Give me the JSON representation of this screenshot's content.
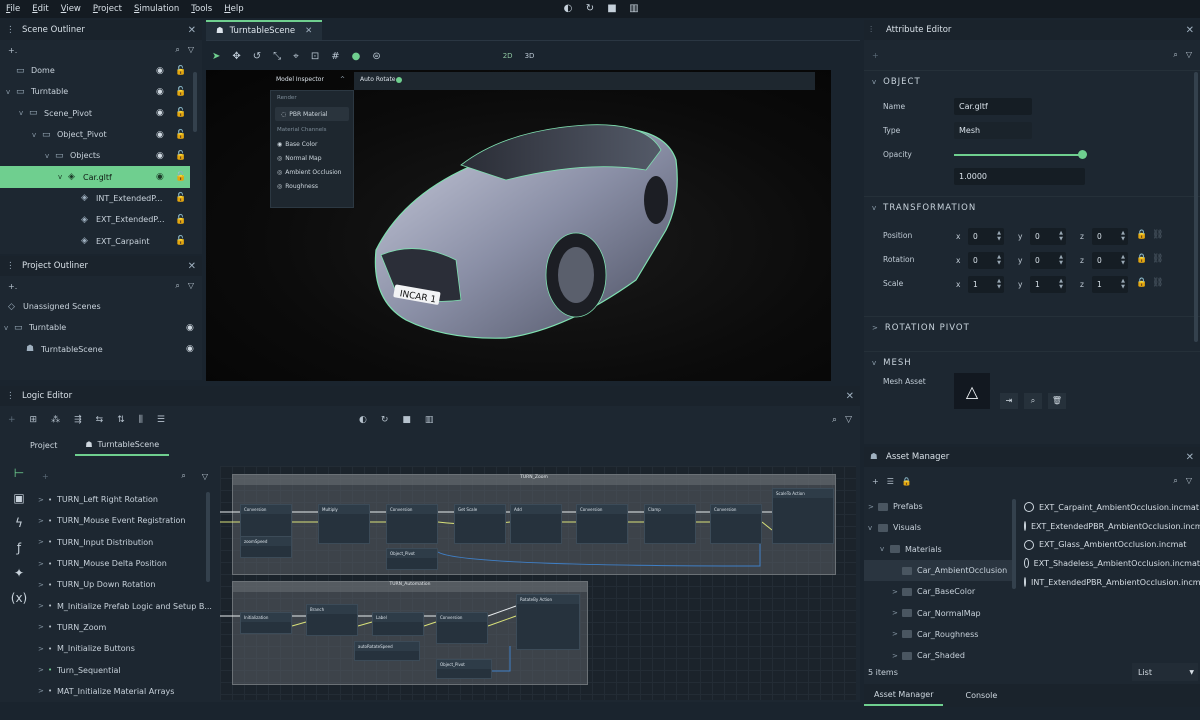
{
  "menu": [
    "File",
    "Edit",
    "View",
    "Project",
    "Simulation",
    "Tools",
    "Help"
  ],
  "sim_icons": [
    "camera-icon",
    "reset-icon",
    "stop-icon",
    "timeline-icon"
  ],
  "scene_outliner": {
    "title": "Scene Outliner",
    "items": [
      {
        "label": "Dome",
        "level": 0,
        "chev": ""
      },
      {
        "label": "Turntable",
        "level": 0,
        "chev": "v"
      },
      {
        "label": "Scene_Pivot",
        "level": 1,
        "chev": "v"
      },
      {
        "label": "Object_Pivot",
        "level": 2,
        "chev": "v"
      },
      {
        "label": "Objects",
        "level": 3,
        "chev": "v"
      },
      {
        "label": "Car.gltf",
        "level": 4,
        "chev": "v",
        "selected": true
      },
      {
        "label": "INT_ExtendedP...",
        "level": 5,
        "chev": ""
      },
      {
        "label": "EXT_ExtendedP...",
        "level": 5,
        "chev": ""
      },
      {
        "label": "EXT_Carpaint",
        "level": 5,
        "chev": ""
      }
    ]
  },
  "project_outliner": {
    "title": "Project Outliner",
    "items": [
      {
        "label": "Unassigned Scenes"
      },
      {
        "label": "Turntable"
      },
      {
        "label": "TurntableScene"
      }
    ]
  },
  "viewport": {
    "tab": "TurntableScene",
    "mode_2d": "2D",
    "mode_3d": "3D",
    "inspector": {
      "title": "Model Inspector",
      "auto_rotate": "Auto Rotate",
      "render_hd": "Render",
      "material": "PBR Material",
      "channels_hd": "Material Channels",
      "channels": [
        "Base Color",
        "Normal Map",
        "Ambient Occlusion",
        "Roughness"
      ]
    },
    "plate": "INCAR 1"
  },
  "attribute_editor": {
    "title": "Attribute Editor",
    "object_hd": "OBJECT",
    "name_label": "Name",
    "name_value": "Car.gltf",
    "type_label": "Type",
    "type_value": "Mesh",
    "opacity_label": "Opacity",
    "opacity_value": "1.0000",
    "opacity_fraction": 1.0,
    "transform_hd": "TRANSFORMATION",
    "position_label": "Position",
    "rotation_label": "Rotation",
    "scale_label": "Scale",
    "position": [
      "0",
      "0",
      "0"
    ],
    "rotation": [
      "0",
      "0",
      "0"
    ],
    "scale": [
      "1",
      "1",
      "1"
    ],
    "axes": [
      "x",
      "y",
      "z"
    ],
    "pivot_hd": "ROTATION PIVOT",
    "mesh_hd": "MESH",
    "mesh_asset_label": "Mesh Asset"
  },
  "logic_editor": {
    "title": "Logic Editor",
    "tab_project": "Project",
    "tab_scene": "TurntableScene",
    "items": [
      "TURN_Left Right Rotation",
      "TURN_Mouse Event Registration",
      "TURN_Input Distribution",
      "TURN_Mouse Delta Position",
      "TURN_Up Down Rotation",
      "M_Initialize Prefab Logic and Setup B...",
      "TURN_Zoom",
      "M_Initialize Buttons",
      "Turn_Sequential",
      "MAT_Initialize Material Arrays"
    ],
    "item_dots": [
      "#b9c3cc",
      "#b9c3cc",
      "#b9c3cc",
      "#b9c3cc",
      "#b9c3cc",
      "#b9c3cc",
      "#b9c3cc",
      "#b9c3cc",
      "#6fcf8f",
      "#b9c3cc"
    ],
    "group1": "TURN_Zoom",
    "group2": "TURN_Automation",
    "nodes_g1": [
      "Conversion",
      "Multiply",
      "Conversion",
      "Get Scale",
      "Add",
      "Conversion",
      "Clamp",
      "Conversion",
      "ScaleTo Action",
      "zoomSpeed",
      "Object_Pivot"
    ],
    "nodes_g2": [
      "Initialization",
      "Branch",
      "Label",
      "Conversion",
      "autoRotateSpeed",
      "Object_Pivot",
      "RotateBy Action"
    ]
  },
  "asset_manager": {
    "title": "Asset Manager",
    "folders": [
      {
        "label": "Prefabs",
        "level": 0,
        "chev": ">"
      },
      {
        "label": "Visuals",
        "level": 0,
        "chev": "v"
      },
      {
        "label": "Materials",
        "level": 1,
        "chev": "v"
      },
      {
        "label": "Car_AmbientOcclusion",
        "level": 2,
        "chev": "",
        "selected": true
      },
      {
        "label": "Car_BaseColor",
        "level": 2,
        "chev": ">"
      },
      {
        "label": "Car_NormalMap",
        "level": 2,
        "chev": ">"
      },
      {
        "label": "Car_Roughness",
        "level": 2,
        "chev": ">"
      },
      {
        "label": "Car_Shaded",
        "level": 2,
        "chev": ">"
      }
    ],
    "files": [
      "EXT_Carpaint_AmbientOcclusion.incmat",
      "EXT_ExtendedPBR_AmbientOcclusion.incmat",
      "EXT_Glass_AmbientOcclusion.incmat",
      "EXT_Shadeless_AmbientOcclusion.incmat",
      "INT_ExtendedPBR_AmbientOcclusion.incmat"
    ],
    "count": "5 items",
    "view_mode": "List",
    "tab_assets": "Asset Manager",
    "tab_console": "Console"
  },
  "colors": {
    "accent": "#6fcf8f",
    "panel": "#1d2731",
    "bg": "#1a242e"
  }
}
